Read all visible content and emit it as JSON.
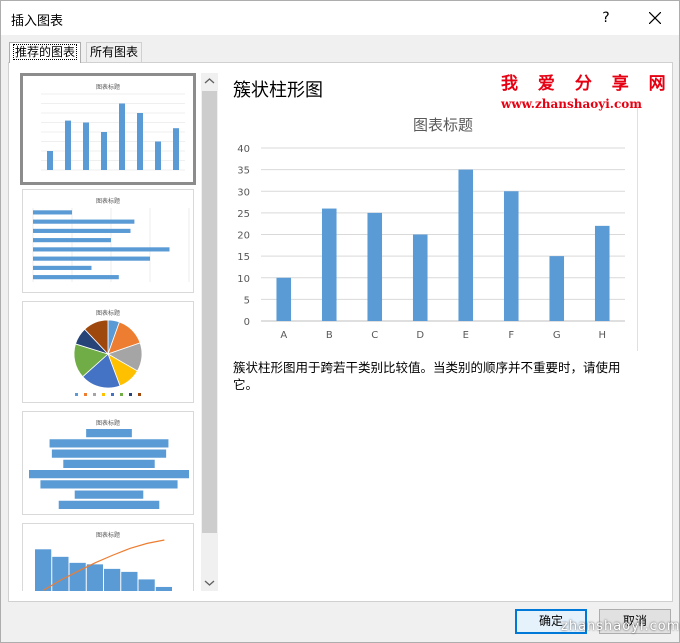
{
  "window": {
    "title": "插入图表",
    "help_label": "?"
  },
  "tabs": [
    {
      "label": "推荐的图表",
      "active": true
    },
    {
      "label": "所有图表",
      "active": false
    }
  ],
  "thumbnails": [
    {
      "type": "clustered-column",
      "title": "图表标题",
      "selected": true
    },
    {
      "type": "clustered-bar",
      "title": "图表标题",
      "selected": false
    },
    {
      "type": "pie",
      "title": "图表标题",
      "selected": false
    },
    {
      "type": "funnel",
      "title": "图表标题",
      "selected": false
    },
    {
      "type": "pareto",
      "title": "图表标题",
      "selected": false
    }
  ],
  "preview": {
    "chart_name": "簇状柱形图",
    "description": "簇状柱形图用于跨若干类别比较值。当类别的顺序并不重要时，请使用它。"
  },
  "watermark": {
    "brand": "我 爱 分 享 网",
    "url": "www.zhanshaoyi.com",
    "bottom": "zhanshaoyi.com"
  },
  "buttons": {
    "ok": "确定",
    "cancel": "取消"
  },
  "colors": {
    "bar": "#5b9bd5",
    "grid": "#d9d9d9",
    "axis_text": "#595959",
    "accent": "#0078d7",
    "watermark": "#e60012"
  },
  "chart_data": {
    "type": "bar",
    "title": "图表标题",
    "categories": [
      "A",
      "B",
      "C",
      "D",
      "E",
      "F",
      "G",
      "H"
    ],
    "values": [
      10,
      26,
      25,
      20,
      35,
      30,
      15,
      22
    ],
    "ylim": [
      0,
      40
    ],
    "yticks": [
      0,
      5,
      10,
      15,
      20,
      25,
      30,
      35,
      40
    ],
    "grid": true,
    "xlabel": "",
    "ylabel": ""
  }
}
